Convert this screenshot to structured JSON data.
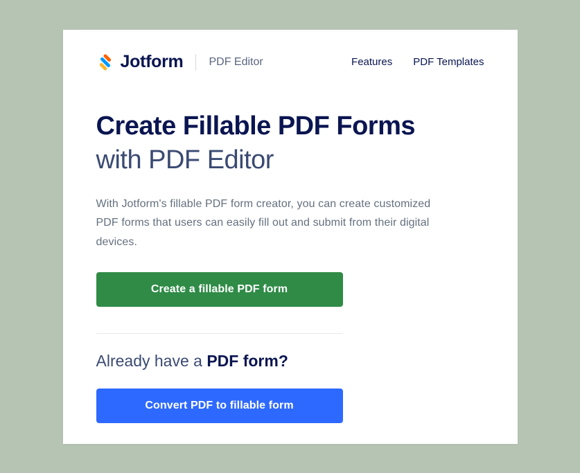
{
  "brand": {
    "name": "Jotform",
    "product": "PDF Editor"
  },
  "nav": {
    "features": "Features",
    "templates": "PDF Templates"
  },
  "hero": {
    "title_bold": "Create Fillable PDF Forms",
    "title_sub": "with PDF Editor",
    "description": "With Jotform's fillable PDF form creator, you can create customized PDF forms that users can easily fill out and submit from their digital devices."
  },
  "buttons": {
    "create": "Create a fillable PDF form",
    "convert": "Convert PDF to fillable form"
  },
  "already": {
    "prefix": "Already have a ",
    "bold": "PDF form?"
  }
}
